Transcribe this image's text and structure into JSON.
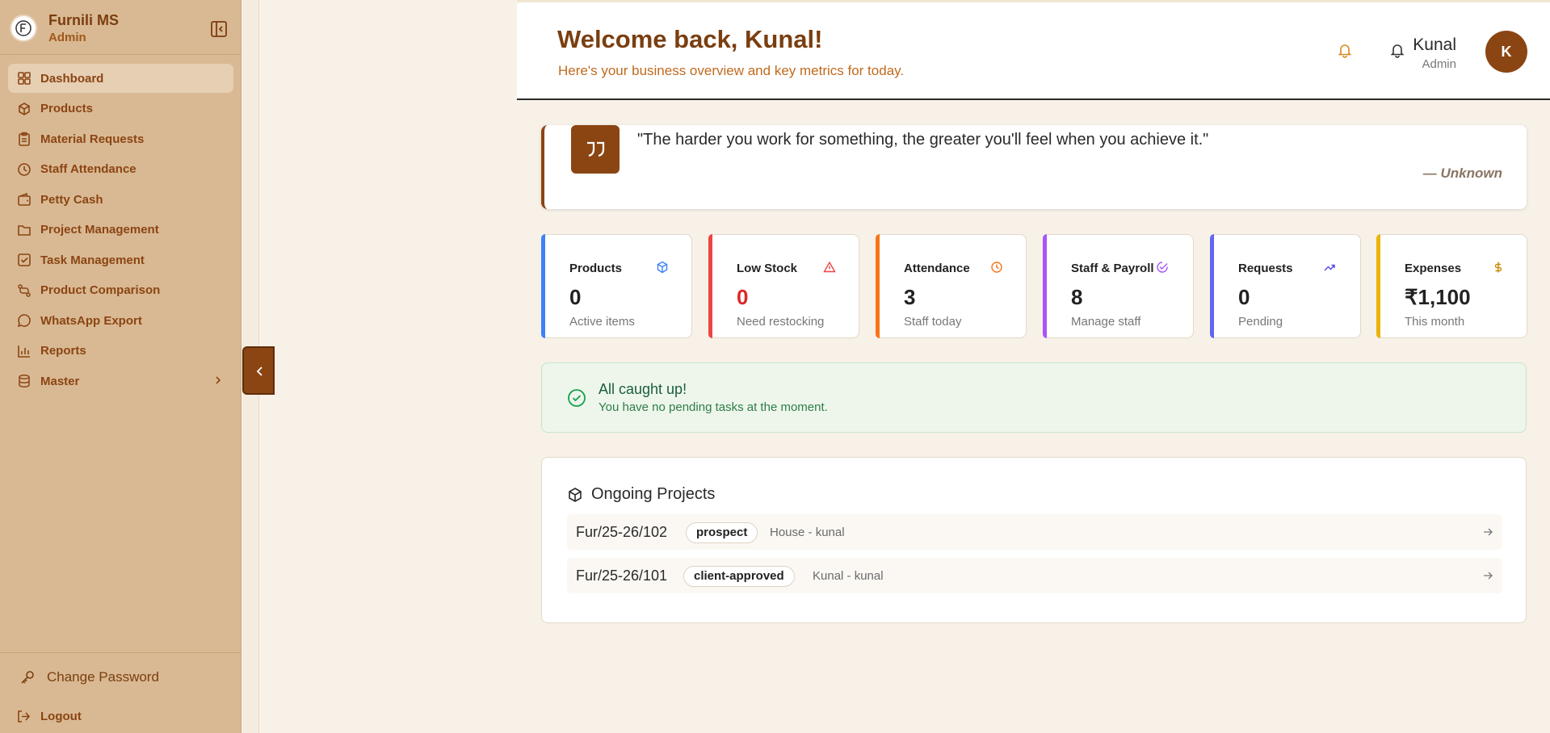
{
  "brand": {
    "name": "Furnili MS",
    "role": "Admin"
  },
  "sidebar": {
    "items": [
      {
        "label": "Dashboard",
        "icon": "dashboard-icon",
        "active": true
      },
      {
        "label": "Products",
        "icon": "box-icon"
      },
      {
        "label": "Material Requests",
        "icon": "clipboard-icon"
      },
      {
        "label": "Staff Attendance",
        "icon": "clock-icon"
      },
      {
        "label": "Petty Cash",
        "icon": "wallet-icon"
      },
      {
        "label": "Project Management",
        "icon": "folder-icon"
      },
      {
        "label": "Task Management",
        "icon": "checkbox-icon"
      },
      {
        "label": "Product Comparison",
        "icon": "compare-icon"
      },
      {
        "label": "WhatsApp Export",
        "icon": "chat-icon"
      },
      {
        "label": "Reports",
        "icon": "chart-icon"
      },
      {
        "label": "Master",
        "icon": "database-icon"
      }
    ],
    "change_password": "Change Password",
    "logout": "Logout"
  },
  "header": {
    "welcome": "Welcome back, Kunal!",
    "subtitle": "Here's your business overview and key metrics for today.",
    "user_name": "Kunal",
    "user_role": "Admin",
    "avatar_initial": "K"
  },
  "quote": {
    "text": "\"The harder you work for something, the greater you'll feel when you achieve it.\"",
    "author": "— Unknown"
  },
  "stats": [
    {
      "title": "Products",
      "value": "0",
      "sub": "Active items",
      "color": "#3b82f6",
      "icon": "box-icon"
    },
    {
      "title": "Low Stock",
      "value": "0",
      "sub": "Need restocking",
      "color": "#ef4444",
      "icon": "alert-triangle-icon"
    },
    {
      "title": "Attendance",
      "value": "3",
      "sub": "Staff today",
      "color": "#f97316",
      "icon": "clock-icon"
    },
    {
      "title": "Staff & Payroll",
      "value": "8",
      "sub": "Manage staff",
      "color": "#a855f7",
      "icon": "check-circle-icon"
    },
    {
      "title": "Requests",
      "value": "0",
      "sub": "Pending",
      "color": "#6366f1",
      "icon": "trending-up-icon"
    },
    {
      "title": "Expenses",
      "value": "₹1,100",
      "sub": "This month",
      "color": "#eab308",
      "icon": "dollar-icon"
    }
  ],
  "caught_up": {
    "title": "All caught up!",
    "message": "You have no pending tasks at the moment."
  },
  "projects": {
    "title": "Ongoing Projects",
    "rows": [
      {
        "code": "Fur/25-26/102",
        "status": "prospect",
        "desc": "House - kunal"
      },
      {
        "code": "Fur/25-26/101",
        "status": "client-approved",
        "desc": "Kunal - kunal"
      }
    ]
  }
}
